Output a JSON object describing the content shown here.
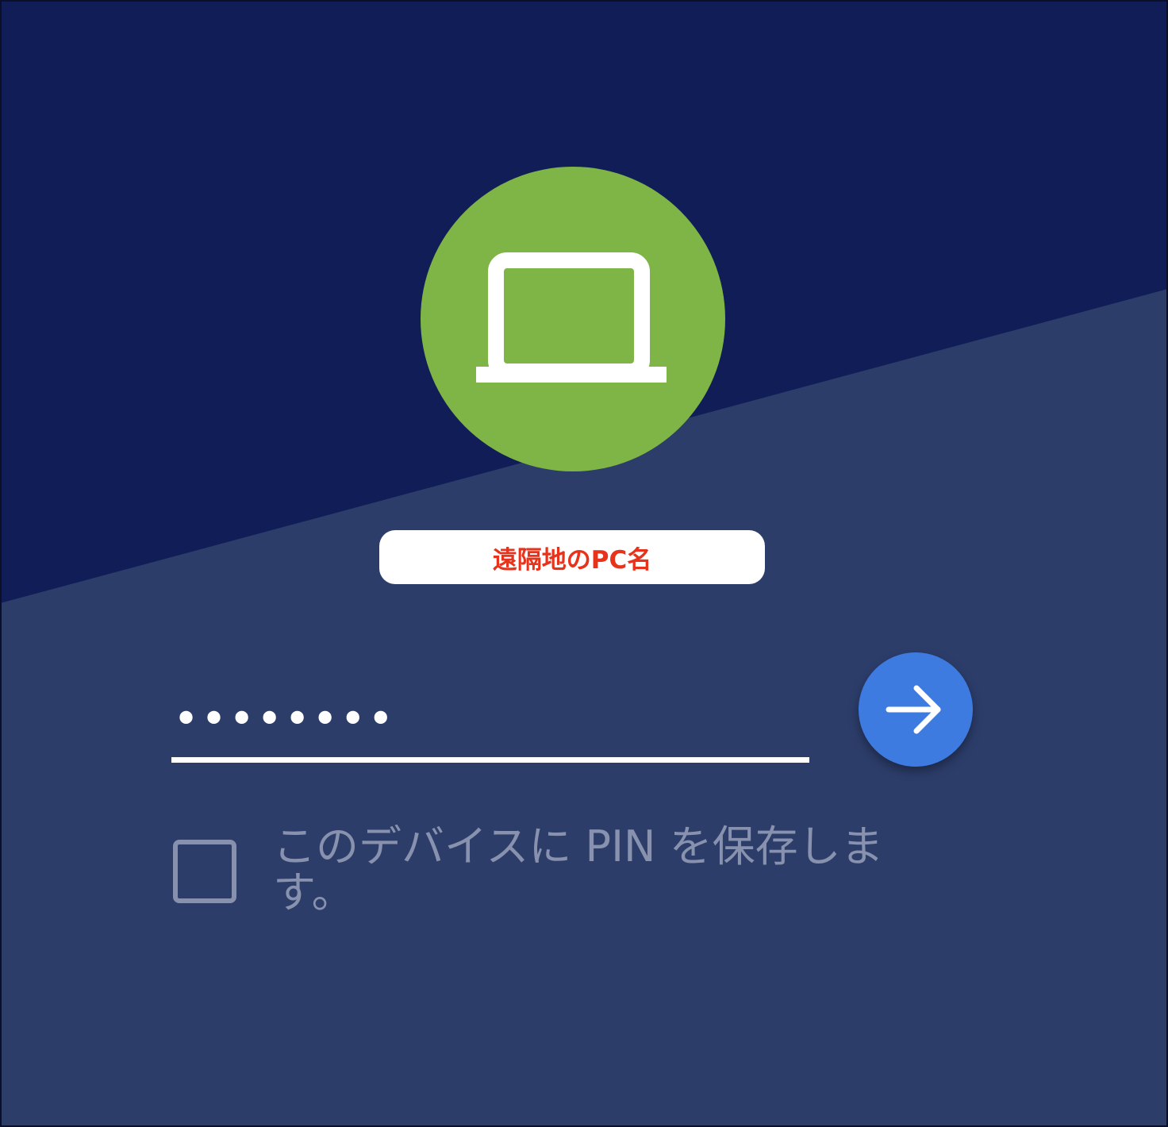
{
  "background": {
    "upper_color": "#101d57",
    "lower_color": "#2c3d6a"
  },
  "host": {
    "avatar_icon": "laptop-icon",
    "avatar_color": "#7fb446",
    "name": "遠隔地のPC名",
    "name_color": "#e8331c"
  },
  "pin": {
    "value": "••••••••"
  },
  "submit": {
    "icon": "arrow-right-icon",
    "color": "#3e7be0"
  },
  "remember": {
    "checked": false,
    "label": "このデバイスに PIN を保存します。"
  }
}
